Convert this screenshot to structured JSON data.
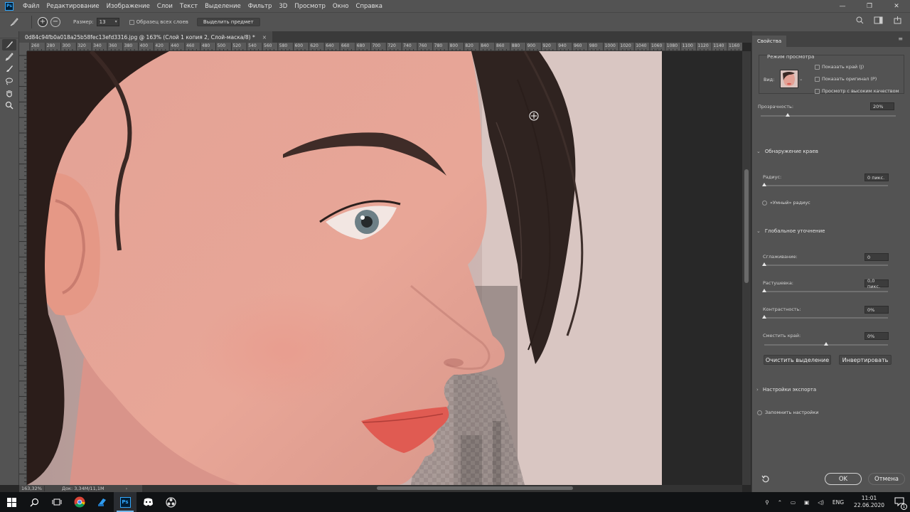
{
  "app": {
    "logo_text": "Ps",
    "menu": [
      "Файл",
      "Редактирование",
      "Изображение",
      "Слои",
      "Текст",
      "Выделение",
      "Фильтр",
      "3D",
      "Просмотр",
      "Окно",
      "Справка"
    ]
  },
  "options_bar": {
    "size_label": "Размер:",
    "size_value": "13",
    "sample_all_layers": "Образец всех слоев",
    "select_subject": "Выделить предмет"
  },
  "document": {
    "tab_title": "0d84c94fb0a018a25b58fec13efd3316.jpg @ 163% (Слой 1 копия 2, Слой-маска/8) *",
    "close": "×"
  },
  "ruler": {
    "ticks": [
      "260",
      "280",
      "300",
      "320",
      "340",
      "360",
      "380",
      "400",
      "420",
      "440",
      "460",
      "480",
      "500",
      "520",
      "540",
      "560",
      "580",
      "600",
      "620",
      "640",
      "660",
      "680",
      "700",
      "720",
      "740",
      "760",
      "780",
      "800",
      "820",
      "840",
      "860",
      "880",
      "900",
      "920",
      "940",
      "960",
      "980",
      "1000",
      "1020",
      "1040",
      "1060",
      "1080",
      "1100",
      "1120",
      "1140",
      "1160"
    ]
  },
  "status_bar": {
    "zoom": "163,32%",
    "doc_size": "Док: 3,34M/11,1M",
    "arrow": "›"
  },
  "properties": {
    "tab": "Свойства",
    "view_mode": {
      "title": "Режим просмотра",
      "view_label": "Вид:",
      "show_edge": "Показать край (J)",
      "show_original": "Показать оригинал (P)",
      "high_quality": "Просмотр с высоким качеством"
    },
    "opacity": {
      "label": "Прозрачность:",
      "value": "20%",
      "level": 0.2
    },
    "edge_detection": {
      "title": "Обнаружение краев",
      "radius_label": "Радиус:",
      "radius_value": "0 пикс.",
      "radius_level": 0,
      "smart_radius": "«Умный» радиус"
    },
    "global_refine": {
      "title": "Глобальное уточнение",
      "smooth_label": "Сглаживание:",
      "smooth_value": "0",
      "smooth_level": 0,
      "feather_label": "Растушевка:",
      "feather_value": "0,0 пикс.",
      "feather_level": 0,
      "contrast_label": "Контрастность:",
      "contrast_value": "0%",
      "contrast_level": 0,
      "shift_label": "Сместить край:",
      "shift_value": "0%",
      "shift_level": 0.5,
      "clear_selection": "Очистить выделение",
      "invert": "Инвертировать"
    },
    "export": {
      "title": "Настройки экспорта"
    },
    "remember": "Запомнить настройки",
    "ok": "OK",
    "cancel": "Отмена"
  },
  "taskbar": {
    "lang": "ENG",
    "time": "11:01",
    "date": "22.06.2020",
    "notif_count": "1"
  },
  "colors": {
    "panel": "#535353",
    "canvas_bg": "#282828",
    "accent": "#31a8ff"
  }
}
